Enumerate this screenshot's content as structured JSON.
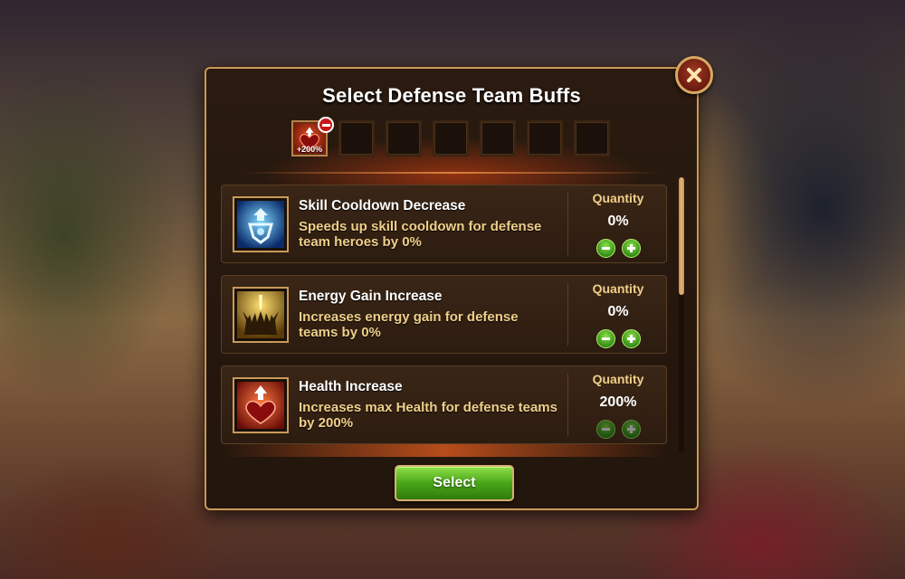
{
  "dialog": {
    "title": "Select Defense Team Buffs",
    "close_icon": "close-x-icon",
    "select_label": "Select"
  },
  "slots": [
    {
      "filled": true,
      "icon": "health-heart-icon",
      "label": "+200%",
      "has_remove": true
    },
    {
      "filled": false
    },
    {
      "filled": false
    },
    {
      "filled": false
    },
    {
      "filled": false
    },
    {
      "filled": false
    },
    {
      "filled": false
    }
  ],
  "buffs": [
    {
      "icon": "skill-cooldown-icon",
      "title": "Skill Cooldown Decrease",
      "description": "Speeds up skill cooldown for defense team heroes by 0%",
      "quantity_label": "Quantity",
      "quantity": "0%"
    },
    {
      "icon": "energy-gain-icon",
      "title": "Energy Gain Increase",
      "description": "Increases energy gain for defense teams by 0%",
      "quantity_label": "Quantity",
      "quantity": "0%"
    },
    {
      "icon": "health-heart-icon",
      "title": "Health Increase",
      "description": "Increases max Health for defense teams by 200%",
      "quantity_label": "Quantity",
      "quantity": "200%"
    }
  ],
  "colors": {
    "panel_border": "#c99a5b",
    "desc_text": "#f0cf8a",
    "select_green": "#4aa618",
    "remove_red": "#c81818"
  }
}
